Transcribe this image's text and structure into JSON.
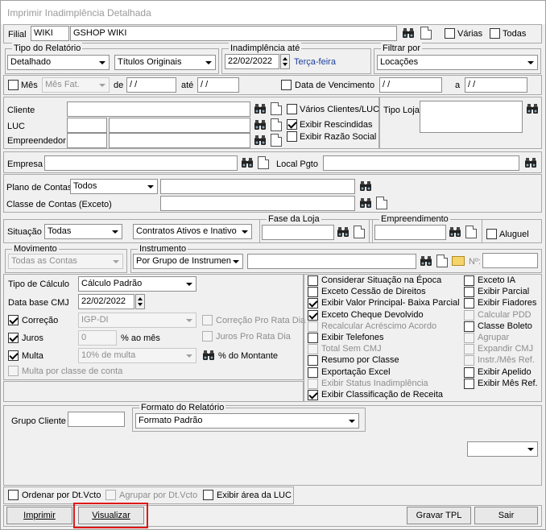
{
  "window": {
    "title": "Imprimir Inadimplência Detalhada"
  },
  "filial": {
    "label": "Filial",
    "code": "WIKI",
    "name": "GSHOP WIKI",
    "varias_label": "Várias",
    "todas_label": "Todas"
  },
  "tipo_relatorio": {
    "label": "Tipo do Relatório",
    "tipo": "Detalhado",
    "titulos": "Títulos Originais"
  },
  "inadimplencia": {
    "label": "Inadimplência até",
    "date": "22/02/2022",
    "weekday": "Terça-feira"
  },
  "filtrar": {
    "label": "Filtrar por",
    "value": "Locações"
  },
  "periodo": {
    "mes_label": "Mês",
    "mes_value": "Mês Fat.",
    "de_label": "de",
    "de_value": " /     /",
    "ate_label": "até",
    "ate_value": " /     /",
    "venc_label": "Data de Vencimento",
    "venc_de": " /     /",
    "a_label": "a",
    "venc_ate": " /     /"
  },
  "cliente": {
    "cliente_label": "Cliente",
    "luc_label": "LUC",
    "empreendedor_label": "Empreendedor",
    "varios_label": "Vários Clientes/LUC",
    "rescindidas_label": "Exibir Rescindidas",
    "razao_label": "Exibir Razão Social",
    "tipo_loja_label": "Tipo Loja"
  },
  "empresa": {
    "label": "Empresa",
    "local_label": "Local Pgto"
  },
  "contas": {
    "plano_label": "Plano de Contas",
    "plano_value": "Todos",
    "classe_label": "Classe de Contas (Exceto)"
  },
  "situacao": {
    "label": "Situação",
    "value": "Todas",
    "contratos": "Contratos Ativos e Inativo",
    "fase_label": "Fase da Loja",
    "empreendimento_label": "Empreendimento",
    "aluguel_label": "Aluguel"
  },
  "movimento": {
    "label": "Movimento",
    "value": "Todas as Contas",
    "instrumento_label": "Instrumento",
    "instrumento_value": "Por Grupo de Instrumen",
    "no_label": "Nº:"
  },
  "calculo": {
    "tipo_label": "Tipo de Cálculo",
    "tipo_value": "Cálculo Padrão",
    "data_label": "Data base CMJ",
    "data_value": "22/02/2022",
    "correcao_label": "Correção",
    "correcao_value": "IGP-DI",
    "pro_rata_label": "Correção Pro Rata Dia",
    "juros_label": "Juros",
    "juros_value": "0",
    "ao_mes_label": "% ao mês",
    "juros_pro_rata_label": "Juros Pro Rata Dia",
    "multa_label": "Multa",
    "multa_value": "10% de multa",
    "montante_label": "% do Montante",
    "multa_classe_label": "Multa por classe de conta"
  },
  "opcoes_col1": [
    {
      "label": "Considerar Situação na Época",
      "checked": false,
      "disabled": false
    },
    {
      "label": "Exceto Cessão de Direitos",
      "checked": false,
      "disabled": false
    },
    {
      "label": "Exibir Valor Principal- Baixa Parcial",
      "checked": true,
      "disabled": false
    },
    {
      "label": "Exceto Cheque Devolvido",
      "checked": true,
      "disabled": false
    },
    {
      "label": "Recalcular Acréscimo Acordo",
      "checked": false,
      "disabled": true
    },
    {
      "label": "Exibir Telefones",
      "checked": false,
      "disabled": false
    },
    {
      "label": "Total Sem CMJ",
      "checked": false,
      "disabled": true
    },
    {
      "label": "Resumo por Classe",
      "checked": false,
      "disabled": false
    },
    {
      "label": "Exportação Excel",
      "checked": false,
      "disabled": false
    },
    {
      "label": "Exibir Status Inadimplência",
      "checked": false,
      "disabled": true
    },
    {
      "label": "Exibir Classificação de Receita",
      "checked": true,
      "disabled": false
    }
  ],
  "opcoes_col2": [
    {
      "label": "Exceto IA",
      "checked": false,
      "disabled": false
    },
    {
      "label": "Exibir Parcial",
      "checked": false,
      "disabled": false
    },
    {
      "label": "Exibir Fiadores",
      "checked": false,
      "disabled": false
    },
    {
      "label": "Calcular PDD",
      "checked": false,
      "disabled": true
    },
    {
      "label": "Classe Boleto",
      "checked": false,
      "disabled": false
    },
    {
      "label": "Agrupar",
      "checked": false,
      "disabled": true
    },
    {
      "label": "Expandir CMJ",
      "checked": false,
      "disabled": true
    },
    {
      "label": "Instr./Mês Ref.",
      "checked": false,
      "disabled": true
    },
    {
      "label": "Exibir Apelido",
      "checked": false,
      "disabled": false
    },
    {
      "label": "Exibir Mês Ref.",
      "checked": false,
      "disabled": false
    }
  ],
  "grupo": {
    "label": "Grupo Cliente"
  },
  "formato": {
    "label": "Formato do Relatório",
    "value": "Formato Padrão"
  },
  "ordenacao": {
    "ordenar_label": "Ordenar por Dt.Vcto",
    "agrupar_label": "Agrupar por Dt.Vcto",
    "area_label": "Exibir área da LUC"
  },
  "buttons": {
    "imprimir": "Imprimir",
    "visualizar": "Visualizar",
    "gravar": "Gravar TPL",
    "sair": "Sair"
  },
  "colors": {
    "accent_red": "#e01818",
    "weekday_blue": "#1c3e9c"
  }
}
